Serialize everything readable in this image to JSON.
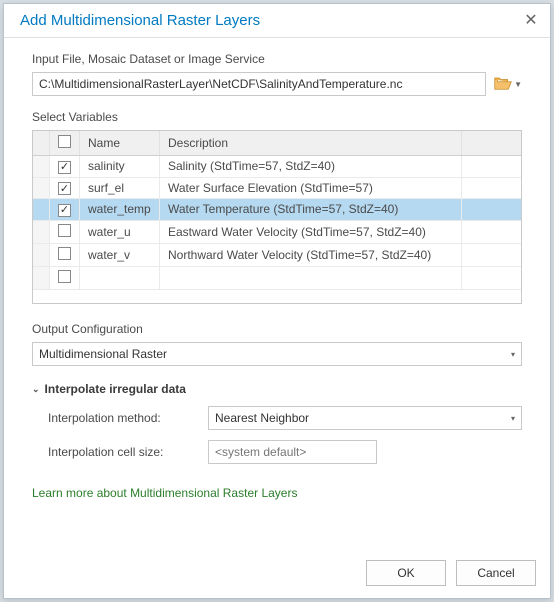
{
  "title": "Add Multidimensional Raster Layers",
  "input_label": "Input File, Mosaic Dataset or Image Service",
  "input_value": "C:\\MultidimensionalRasterLayer\\NetCDF\\SalinityAndTemperature.nc",
  "select_variables_label": "Select Variables",
  "columns": {
    "name": "Name",
    "description": "Description"
  },
  "rows": [
    {
      "checked": true,
      "selected": false,
      "name": "salinity",
      "description": "Salinity (StdTime=57, StdZ=40)"
    },
    {
      "checked": true,
      "selected": false,
      "name": "surf_el",
      "description": "Water Surface Elevation (StdTime=57)"
    },
    {
      "checked": true,
      "selected": true,
      "name": "water_temp",
      "description": "Water Temperature (StdTime=57, StdZ=40)"
    },
    {
      "checked": false,
      "selected": false,
      "name": "water_u",
      "description": "Eastward Water Velocity (StdTime=57, StdZ=40)"
    },
    {
      "checked": false,
      "selected": false,
      "name": "water_v",
      "description": "Northward Water Velocity (StdTime=57, StdZ=40)"
    },
    {
      "checked": false,
      "selected": false,
      "name": "",
      "description": ""
    }
  ],
  "output_config_label": "Output Configuration",
  "output_config_value": "Multidimensional Raster",
  "interpolate_section": "Interpolate irregular data",
  "interp_method_label": "Interpolation method:",
  "interp_method_value": "Nearest Neighbor",
  "interp_cell_label": "Interpolation cell size:",
  "interp_cell_placeholder": "<system default>",
  "learn_more": "Learn more about Multidimensional Raster Layers",
  "buttons": {
    "ok": "OK",
    "cancel": "Cancel"
  }
}
